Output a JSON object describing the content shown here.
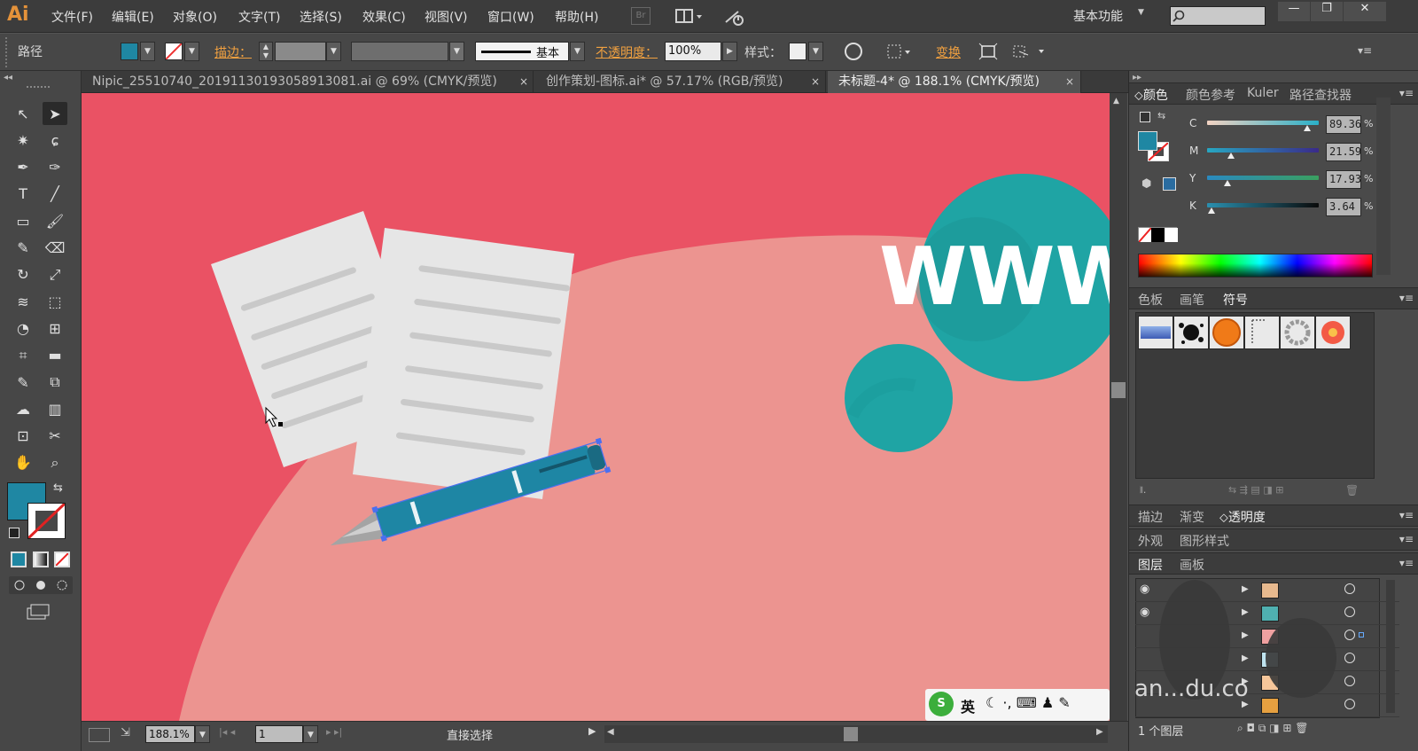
{
  "app": {
    "logo": "Ai",
    "workspace": "基本功能",
    "window_controls": [
      "—",
      "❐",
      "✕"
    ]
  },
  "menus": [
    "文件(F)",
    "编辑(E)",
    "对象(O)",
    "文字(T)",
    "选择(S)",
    "效果(C)",
    "视图(V)",
    "窗口(W)",
    "帮助(H)"
  ],
  "menubar_icons": {
    "bridge": "Br",
    "arrange": "arrange-documents-icon",
    "sync": "sync-icon",
    "search": "search-icon"
  },
  "control": {
    "path_label": "路径",
    "stroke_label": "描边：",
    "opacity_label": "不透明度：",
    "opacity_value": "100%",
    "stroke_style": "基本",
    "style_label": "样式：",
    "transform_label": "变换",
    "fill_color": "#1f87a3"
  },
  "tabs": [
    {
      "label": "Nipic_25510740_20191130193058913081.ai @ 69% (CMYK/预览)",
      "close": "×"
    },
    {
      "label": "创作策划-图标.ai* @ 57.17% (RGB/预览)",
      "close": "×"
    },
    {
      "label": "未标题-4* @ 188.1% (CMYK/预览)",
      "close": "×"
    }
  ],
  "tools": [
    "selection-tool",
    "direct-selection-tool",
    "magic-wand-tool",
    "lasso-tool",
    "pen-tool",
    "curvature-tool",
    "type-tool",
    "line-tool",
    "rectangle-tool",
    "paintbrush-tool",
    "pencil-tool",
    "eraser-tool",
    "rotate-tool",
    "scale-tool",
    "warp-tool",
    "free-transform-tool",
    "shape-builder-tool",
    "perspective-tool",
    "mesh-tool",
    "gradient-tool",
    "eyedropper-tool",
    "blend-tool",
    "symbol-sprayer-tool",
    "column-graph-tool",
    "artboard-tool",
    "slice-tool",
    "hand-tool",
    "zoom-tool"
  ],
  "tool_glyphs": [
    "↖",
    "➤",
    "✷",
    "ɕ",
    "✒",
    "✑",
    "T",
    "╱",
    "▭",
    "🖌",
    "✎",
    "⌫",
    "↻",
    "⤢",
    "≋",
    "⬚",
    "◔",
    "⊞",
    "⌗",
    "▬",
    "✎",
    "⧉",
    "☁",
    "▥",
    "⊡",
    "✂",
    "✋",
    "⌕"
  ],
  "canvas": {
    "colors": {
      "background": "#ea5264",
      "hill": "#ec9490",
      "teal": "#1fa4a4",
      "paper": "#e6e6e6",
      "pen": "#1e86a4"
    },
    "www_text": "WWW"
  },
  "status": {
    "zoom": "188.1%",
    "page": "1",
    "tool_name": "直接选择"
  },
  "color_panel": {
    "tabs": [
      "颜色",
      "颜色参考",
      "Kuler",
      "路径查找器"
    ],
    "channels": [
      {
        "label": "C",
        "value": "89.36",
        "fraction": 0.8936
      },
      {
        "label": "M",
        "value": "21.59",
        "fraction": 0.2159
      },
      {
        "label": "Y",
        "value": "17.93",
        "fraction": 0.1793
      },
      {
        "label": "K",
        "value": "3.64",
        "fraction": 0.0364
      }
    ],
    "percent": "%"
  },
  "symbols_panel": {
    "tabs": [
      "色板",
      "画笔",
      "符号"
    ]
  },
  "appearance_panel": {
    "tabs1": [
      "描边",
      "渐变",
      "透明度"
    ],
    "tabs2": [
      "外观",
      "图形样式"
    ]
  },
  "layers_panel": {
    "tabs": [
      "图层",
      "画板"
    ],
    "count": "1 个图层"
  },
  "watermark": {
    "ime": "英",
    "text": "an...du.co"
  }
}
